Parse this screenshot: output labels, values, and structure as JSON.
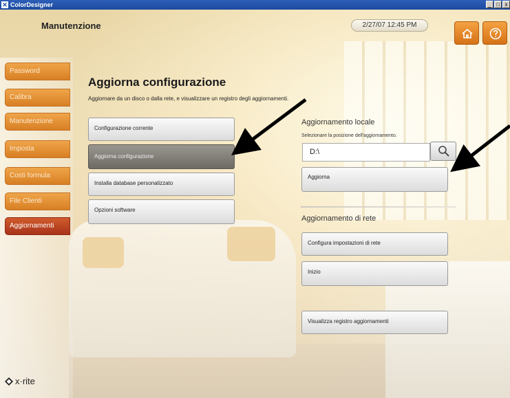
{
  "window": {
    "app_title": "ColorDesigner",
    "app_icon": "logo-icon",
    "controls": [
      "_",
      "□",
      "x"
    ]
  },
  "header": {
    "title": "Manutenzione",
    "datetime": "2/27/07 12:45 PM",
    "home_icon": "home-icon",
    "help_icon": "help-icon"
  },
  "sidebar": {
    "items": [
      {
        "label": "Password"
      },
      {
        "label": "Calibra"
      },
      {
        "label": "Manutenzione"
      },
      {
        "label": "Imposta"
      },
      {
        "label": "Costi formula"
      },
      {
        "label": "File Clienti"
      },
      {
        "label": "Aggiornamenti",
        "active": true
      }
    ],
    "brand": "x·rite"
  },
  "main": {
    "title": "Aggiorna configurazione",
    "description": "Aggiornare da un disco o dalla rete, e visualizzare un registro degli aggiornamenti.",
    "menu": [
      {
        "label": "Configurazione corrente"
      },
      {
        "label": "Aggiorna configurazione",
        "selected": true
      },
      {
        "label": "Installa database personalizzato"
      },
      {
        "label": "Opzioni software"
      }
    ],
    "local": {
      "heading": "Aggiornamento locale",
      "hint": "Selezionare la posizione dell'aggiornamento.",
      "path_value": "D:\\",
      "update_label": "Aggiorna"
    },
    "network": {
      "heading": "Aggiornamento di rete",
      "configure_label": "Configura impostazioni di rete",
      "start_label": "Inizio"
    },
    "log_label": "Visualizza registro aggiornamenti"
  },
  "colors": {
    "accent": "#e08a2c",
    "active": "#b8401f"
  }
}
